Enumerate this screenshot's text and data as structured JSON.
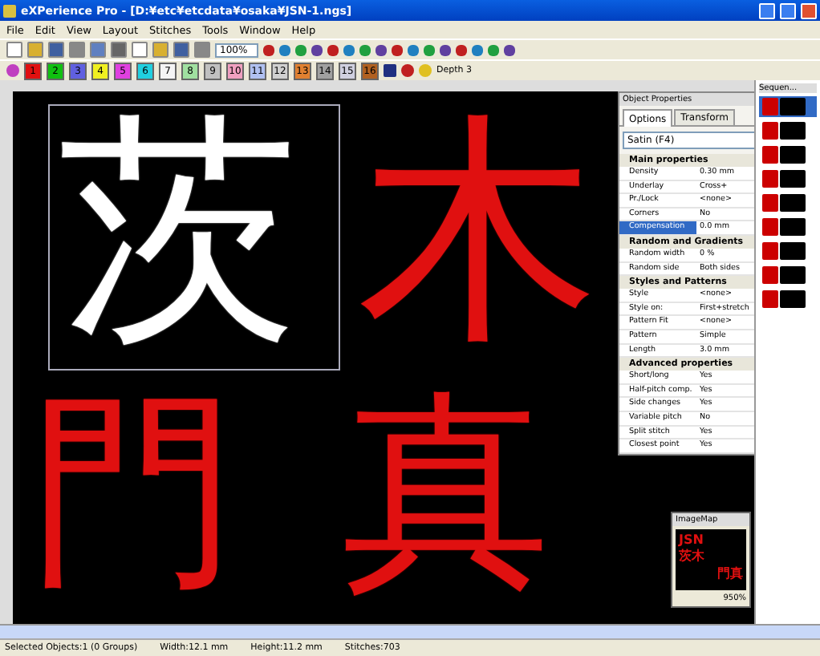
{
  "window": {
    "title": "eXPerience Pro - [D:¥etc¥etcdata¥osaka¥JSN-1.ngs]"
  },
  "menu": [
    "File",
    "Edit",
    "View",
    "Layout",
    "Stitches",
    "Tools",
    "Window",
    "Help"
  ],
  "toolbar": {
    "zoom": "100%"
  },
  "colors": [
    {
      "label": "1",
      "color": "#e01010"
    },
    {
      "label": "2",
      "color": "#10c010"
    },
    {
      "label": "3",
      "color": "#6060e0"
    },
    {
      "label": "4",
      "color": "#f0f020"
    },
    {
      "label": "5",
      "color": "#e040e0"
    },
    {
      "label": "6",
      "color": "#20d0e0"
    },
    {
      "label": "7",
      "color": "#f4f4f4"
    },
    {
      "label": "8",
      "color": "#a0e0a0"
    },
    {
      "label": "9",
      "color": "#c0c0c0"
    },
    {
      "label": "10",
      "color": "#f0a0c0"
    },
    {
      "label": "11",
      "color": "#b0c0f0"
    },
    {
      "label": "12",
      "color": "#d0d0d0"
    },
    {
      "label": "13",
      "color": "#e08030"
    },
    {
      "label": "14",
      "color": "#a0a0a0"
    },
    {
      "label": "15",
      "color": "#d0d0e0"
    },
    {
      "label": "16",
      "color": "#b06020"
    }
  ],
  "depth": "Depth 3",
  "canvas": {
    "glyphs": [
      {
        "char": "茨",
        "selected": true
      },
      {
        "char": "木",
        "selected": false
      },
      {
        "char": "門",
        "selected": false
      },
      {
        "char": "真",
        "selected": false
      }
    ]
  },
  "properties": {
    "title": "Object Properties",
    "tabs": [
      {
        "label": "Options",
        "selected": true
      },
      {
        "label": "Transform",
        "selected": false
      }
    ],
    "stitch_type": "Satin (F4)",
    "sections": [
      {
        "title": "Main properties",
        "rows": [
          {
            "name": "Density",
            "value": "0.30 mm",
            "selected": false
          },
          {
            "name": "Underlay",
            "value": "Cross+",
            "selected": false
          },
          {
            "name": "Pr./Lock",
            "value": "<none>",
            "selected": false
          },
          {
            "name": "Corners",
            "value": "No",
            "selected": false
          },
          {
            "name": "Compensation",
            "value": "0.0 mm",
            "selected": true
          }
        ]
      },
      {
        "title": "Random and Gradients",
        "rows": [
          {
            "name": "Random width",
            "value": "0 %",
            "selected": false
          },
          {
            "name": "Random side",
            "value": "Both sides",
            "selected": false
          }
        ]
      },
      {
        "title": "Styles and Patterns",
        "rows": [
          {
            "name": "Style",
            "value": "<none>",
            "selected": false
          },
          {
            "name": "Style on:",
            "value": "First+stretch",
            "selected": false
          },
          {
            "name": "Pattern Fit",
            "value": "<none>",
            "selected": false
          },
          {
            "name": "Pattern",
            "value": "Simple",
            "selected": false
          },
          {
            "name": "Length",
            "value": "3.0 mm",
            "selected": false
          }
        ]
      },
      {
        "title": "Advanced properties",
        "rows": [
          {
            "name": "Short/long",
            "value": "Yes",
            "selected": false
          },
          {
            "name": "Half-pitch comp.",
            "value": "Yes",
            "selected": false
          },
          {
            "name": "Side changes",
            "value": "Yes",
            "selected": false
          },
          {
            "name": "Variable pitch",
            "value": "No",
            "selected": false
          },
          {
            "name": "Split stitch",
            "value": "Yes",
            "selected": false
          },
          {
            "name": "Closest point",
            "value": "Yes",
            "selected": false
          }
        ]
      }
    ]
  },
  "sequence": {
    "title": "Sequen...",
    "items": [
      {
        "selected": true
      },
      {
        "selected": false
      },
      {
        "selected": false
      },
      {
        "selected": false
      },
      {
        "selected": false
      },
      {
        "selected": false
      },
      {
        "selected": false
      },
      {
        "selected": false
      },
      {
        "selected": false
      }
    ]
  },
  "imagemap": {
    "title": "ImageMap",
    "preview": [
      "JSN",
      "茨木",
      "門真"
    ],
    "zoom": "950%"
  },
  "status_bar": [
    "Selected Objects:1 (0 Groups)",
    "Width:12.1 mm",
    "Height:11.2 mm",
    "Stitches:703"
  ]
}
